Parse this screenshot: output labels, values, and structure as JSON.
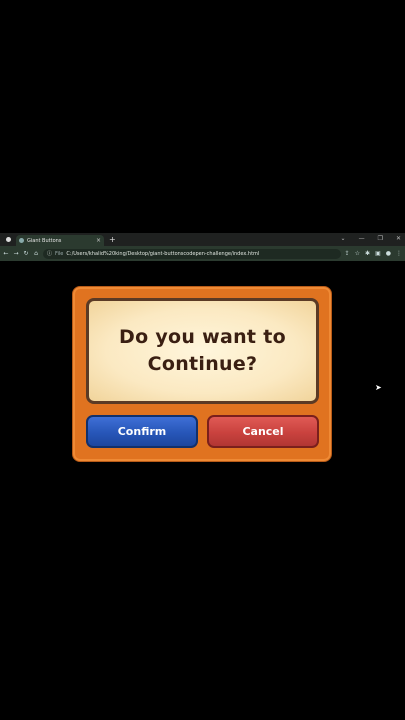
{
  "browser": {
    "tab_title": "Giant Buttons",
    "tab_close": "×",
    "new_tab": "+",
    "window_controls": [
      "⌄",
      "—",
      "❐",
      "✕"
    ],
    "nav": {
      "back": "←",
      "forward": "→",
      "reload": "↻",
      "home": "⌂"
    },
    "url_label": "File",
    "url": "C:/Users/khalid%20king/Desktop/giant-buttonscodepen-challenge/index.html",
    "toolbar_icons": [
      "share-icon",
      "star-icon",
      "extensions-icon",
      "sidebar-icon",
      "avatar",
      "menu-icon"
    ]
  },
  "dialog": {
    "message_line1": "Do you want to",
    "message_line2": "Continue?",
    "confirm_label": "Confirm",
    "cancel_label": "Cancel"
  },
  "colors": {
    "frame": "#e07320",
    "panel": "#fbe9c2",
    "confirm": "#2756b8",
    "cancel": "#c9423e",
    "text": "#3a1f12"
  }
}
